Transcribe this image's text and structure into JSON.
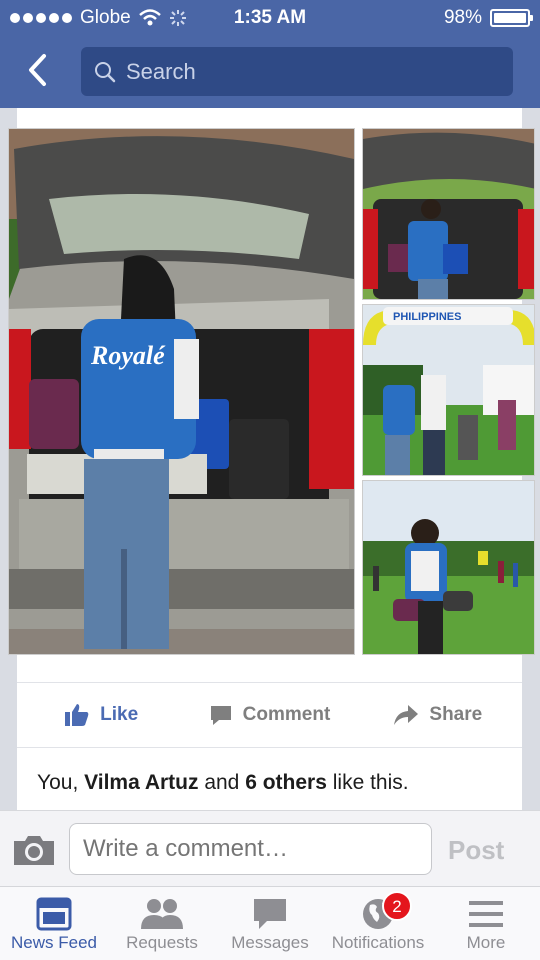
{
  "status": {
    "carrier": "Globe",
    "time": "1:35 AM",
    "battery": "98%"
  },
  "nav": {
    "search_placeholder": "Search"
  },
  "post_actions": {
    "like": "Like",
    "comment": "Comment",
    "share": "Share"
  },
  "likes": {
    "prefix": "You, ",
    "name": "Vilma Artuz",
    "middle": " and ",
    "others": "6 others",
    "suffix": " like this."
  },
  "comment_bar": {
    "placeholder": "Write a comment…",
    "post": "Post"
  },
  "tabs": [
    {
      "label": "News Feed",
      "icon": "news-feed-icon",
      "active": true
    },
    {
      "label": "Requests",
      "icon": "friend-requests-icon"
    },
    {
      "label": "Messages",
      "icon": "messages-icon"
    },
    {
      "label": "Notifications",
      "icon": "globe-icon",
      "badge": "2"
    },
    {
      "label": "More",
      "icon": "menu-icon"
    }
  ],
  "photos": {
    "banner_text": "PHILIPPINES",
    "jacket_text": "Royalé"
  },
  "colors": {
    "brand": "#4a66a6",
    "like": "#4b6bb3",
    "badge": "#e4161d"
  }
}
